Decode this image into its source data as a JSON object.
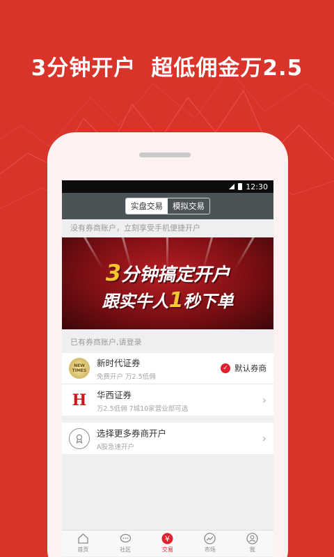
{
  "promo": {
    "headline_1": "3分钟开户",
    "headline_2": "超低佣金万2.5"
  },
  "status_bar": {
    "time": "12:30"
  },
  "segmented": {
    "real_trade": "实盘交易",
    "sim_trade": "模拟交易"
  },
  "hint_no_account": "没有券商账户，立刻享受手机便捷开户",
  "banner": {
    "line1_prefix": "3",
    "line1_rest": "分钟搞定开户",
    "line2_prefix": "跟实牛人",
    "line2_number": "1",
    "line2_suffix": "秒下单"
  },
  "section_has_account": "已有券商账户,请登录",
  "brokers": [
    {
      "logo_text": "NEW TIMES",
      "name": "新时代证券",
      "sub": "免费开户 万2.5低佣",
      "badge": "默认券商"
    },
    {
      "logo_text": "H",
      "name": "华西证券",
      "sub": "万2.5低佣 7城10家营业部可选"
    }
  ],
  "more": {
    "name": "选择更多券商开户",
    "sub": "A股急速开户"
  },
  "tabs": [
    {
      "label": "首页",
      "icon": "home-icon"
    },
    {
      "label": "社区",
      "icon": "chat-icon"
    },
    {
      "label": "交易",
      "icon": "yen-icon"
    },
    {
      "label": "市场",
      "icon": "trend-icon"
    },
    {
      "label": "我",
      "icon": "user-icon"
    }
  ],
  "colors": {
    "brand_red": "#d8342a",
    "accent_red": "#e0202e",
    "topbar": "#4b5357",
    "gold": "#f3c631"
  }
}
